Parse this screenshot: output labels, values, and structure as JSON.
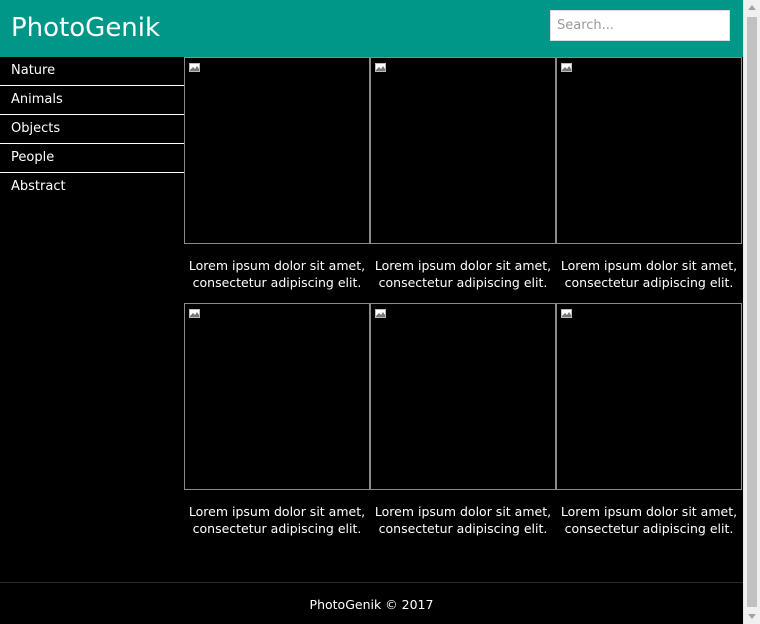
{
  "header": {
    "brand": "PhotoGenik",
    "search_placeholder": "Search...",
    "background_color": "#009688"
  },
  "sidebar": {
    "items": [
      {
        "label": "Nature"
      },
      {
        "label": "Animals"
      },
      {
        "label": "Objects"
      },
      {
        "label": "People"
      },
      {
        "label": "Abstract"
      }
    ]
  },
  "gallery": {
    "broken_image_icon": "broken-image-icon",
    "cards": [
      {
        "caption": "Lorem ipsum dolor sit amet, consectetur adipiscing elit."
      },
      {
        "caption": "Lorem ipsum dolor sit amet, consectetur adipiscing elit."
      },
      {
        "caption": "Lorem ipsum dolor sit amet, consectetur adipiscing elit."
      },
      {
        "caption": "Lorem ipsum dolor sit amet, consectetur adipiscing elit."
      },
      {
        "caption": "Lorem ipsum dolor sit amet, consectetur adipiscing elit."
      },
      {
        "caption": "Lorem ipsum dolor sit amet, consectetur adipiscing elit."
      }
    ]
  },
  "footer": {
    "text": "PhotoGenik © 2017"
  }
}
